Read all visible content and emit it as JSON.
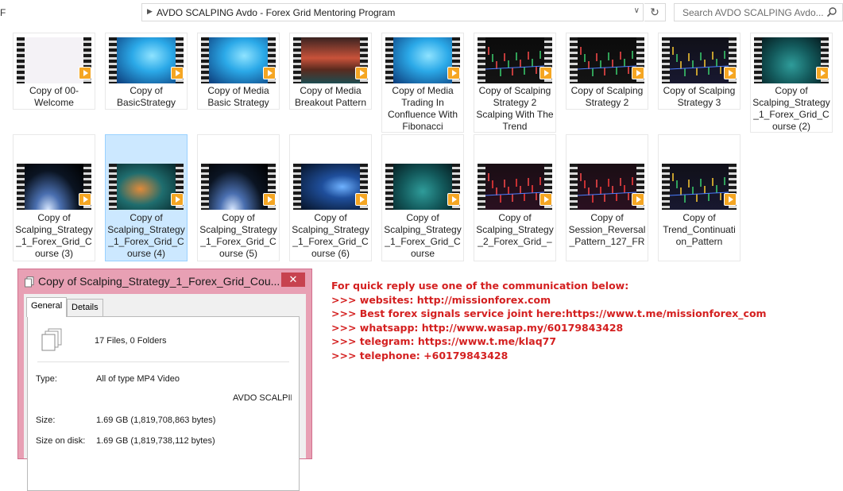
{
  "window": {
    "left_fragment": "F",
    "address_path": "AVDO SCALPING Avdo - Forex Grid Mentoring Program",
    "search_placeholder": "Search AVDO SCALPING Avdo..."
  },
  "files": [
    {
      "name": "Copy of 00-Welcome",
      "thumb": "welcome",
      "selected": false
    },
    {
      "name": "Copy of BasicStrategy",
      "thumb": "blue",
      "selected": false
    },
    {
      "name": "Copy of Media Basic Strategy",
      "thumb": "blue",
      "selected": false
    },
    {
      "name": "Copy of Media Breakout Pattern",
      "thumb": "red",
      "selected": false
    },
    {
      "name": "Copy of Media Trading In Confluence With Fibonacci",
      "thumb": "blue",
      "selected": false
    },
    {
      "name": "Copy of Scalping Strategy 2 Scalping With The Trend",
      "thumb": "chartdark",
      "selected": false
    },
    {
      "name": "Copy of Scalping Strategy 2",
      "thumb": "chartdark",
      "selected": false
    },
    {
      "name": "Copy of Scalping Strategy 3",
      "thumb": "chartcolor",
      "selected": false
    },
    {
      "name": "Copy of Scalping_Strategy_1_Forex_Grid_Course (2)",
      "thumb": "teal",
      "selected": false
    },
    {
      "name": "Copy of Scalping_Strategy_1_Forex_Grid_Course (3)",
      "thumb": "earth",
      "selected": false
    },
    {
      "name": "Copy of Scalping_Strategy_1_Forex_Grid_Course (4)",
      "thumb": "tealorange",
      "selected": true
    },
    {
      "name": "Copy of Scalping_Strategy_1_Forex_Grid_Course (5)",
      "thumb": "earth",
      "selected": false
    },
    {
      "name": "Copy of Scalping_Strategy_1_Forex_Grid_Course (6)",
      "thumb": "bluedark",
      "selected": false
    },
    {
      "name": "Copy of Scalping_Strategy_1_Forex_Grid_Course",
      "thumb": "teal",
      "selected": false
    },
    {
      "name": "Copy of Scalping_Strategy_2_Forex_Grid_–",
      "thumb": "chartred",
      "selected": false
    },
    {
      "name": "Copy of Session_Reversal_Pattern_127_FR",
      "thumb": "chartred",
      "selected": false
    },
    {
      "name": "Copy of Trend_Continuation_Pattern",
      "thumb": "chartcolor",
      "selected": false
    }
  ],
  "dialog": {
    "title": "Copy of Scalping_Strategy_1_Forex_Grid_Cou...",
    "close_label": "✕",
    "tabs": [
      "General",
      "Details"
    ],
    "count_text": "17 Files, 0 Folders",
    "type_label": "Type:",
    "type_value": "All of type MP4 Video",
    "location_value": "AVDO SCALPIN",
    "size_label": "Size:",
    "size_value": "1.69 GB (1,819,708,863 bytes)",
    "size_on_disk_label": "Size on disk:",
    "size_on_disk_value": "1.69 GB (1,819,738,112 bytes)"
  },
  "contact": [
    "For quick reply use one of the communication below:",
    ">>> websites: http://missionforex.com",
    ">>> Best forex signals service joint here:https://www.t.me/missionforex_com",
    ">>> whatsapp: http://www.wasap.my/60179843428",
    ">>> telegram: https://www.t.me/klaq77",
    ">>> telephone: +60179843428"
  ],
  "colors": {
    "contact_text": "#d42020",
    "selection": "#cce8ff",
    "dialog_frame": "#e8a0b4",
    "close_button": "#c7424f"
  }
}
